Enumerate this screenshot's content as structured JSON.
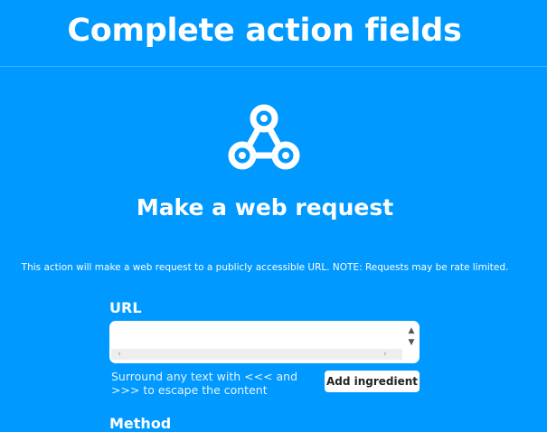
{
  "header": {
    "title": "Complete action fields"
  },
  "action": {
    "service_icon": "webhooks-icon",
    "title": "Make a web request",
    "description": "This action will make a web request to a publicly accessible URL. NOTE: Requests may be rate limited."
  },
  "fields": {
    "url": {
      "label": "URL",
      "value": "",
      "helper": "Surround any text with <<< and >>> to escape the content",
      "add_ingredient_label": "Add ingredient"
    },
    "method": {
      "label": "Method"
    }
  },
  "colors": {
    "background": "#0099ff",
    "text": "#ffffff",
    "button_background": "#ffffff",
    "button_text": "#222222"
  }
}
